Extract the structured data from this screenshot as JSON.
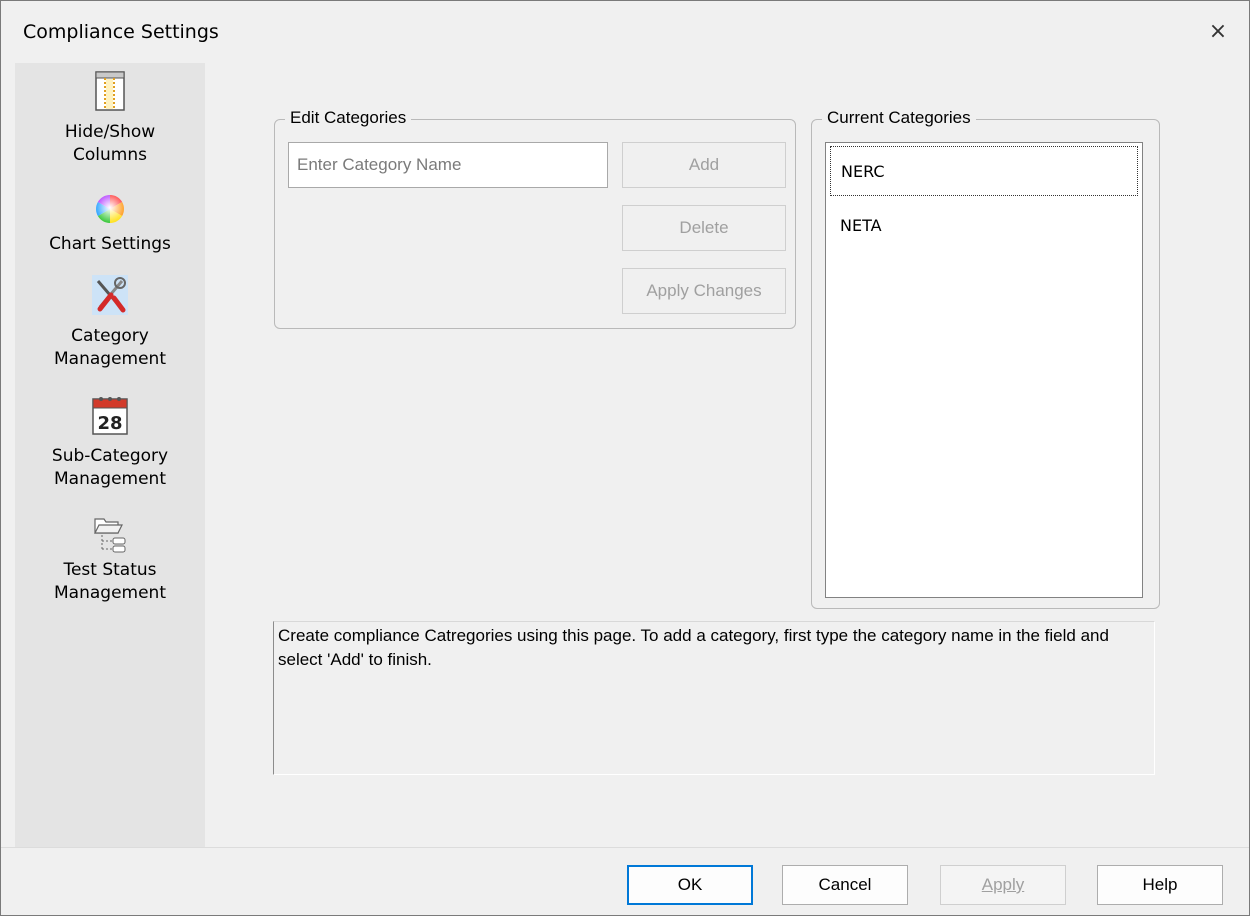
{
  "window": {
    "title": "Compliance Settings",
    "close_symbol": "×"
  },
  "sidebar": {
    "items": [
      {
        "label": "Hide/Show\nColumns",
        "icon": "columns-icon"
      },
      {
        "label": "Chart Settings",
        "icon": "color-wheel-icon"
      },
      {
        "label": "Category\nManagement",
        "icon": "tools-icon"
      },
      {
        "label": "Sub-Category\nManagement",
        "icon": "calendar-icon",
        "icon_text": "28"
      },
      {
        "label": "Test Status\nManagement",
        "icon": "folder-tree-icon"
      }
    ]
  },
  "edit_categories": {
    "legend": "Edit Categories",
    "input_placeholder": "Enter Category Name",
    "input_value": "",
    "add_label": "Add",
    "delete_label": "Delete",
    "apply_changes_label": "Apply Changes"
  },
  "current_categories": {
    "legend": "Current Categories",
    "items": [
      "NERC",
      "NETA"
    ],
    "selected_index": 0
  },
  "description": {
    "text": "Create compliance Catregories using this page.  To add a category, first type the category name in the field and select 'Add' to finish."
  },
  "footer": {
    "ok_label": "OK",
    "cancel_label": "Cancel",
    "apply_label": "Apply",
    "help_label": "Help"
  },
  "colors": {
    "default_button_border": "#0078d7",
    "disabled_text": "#a0a0a0",
    "sidebar_bg": "#e4e4e4"
  }
}
